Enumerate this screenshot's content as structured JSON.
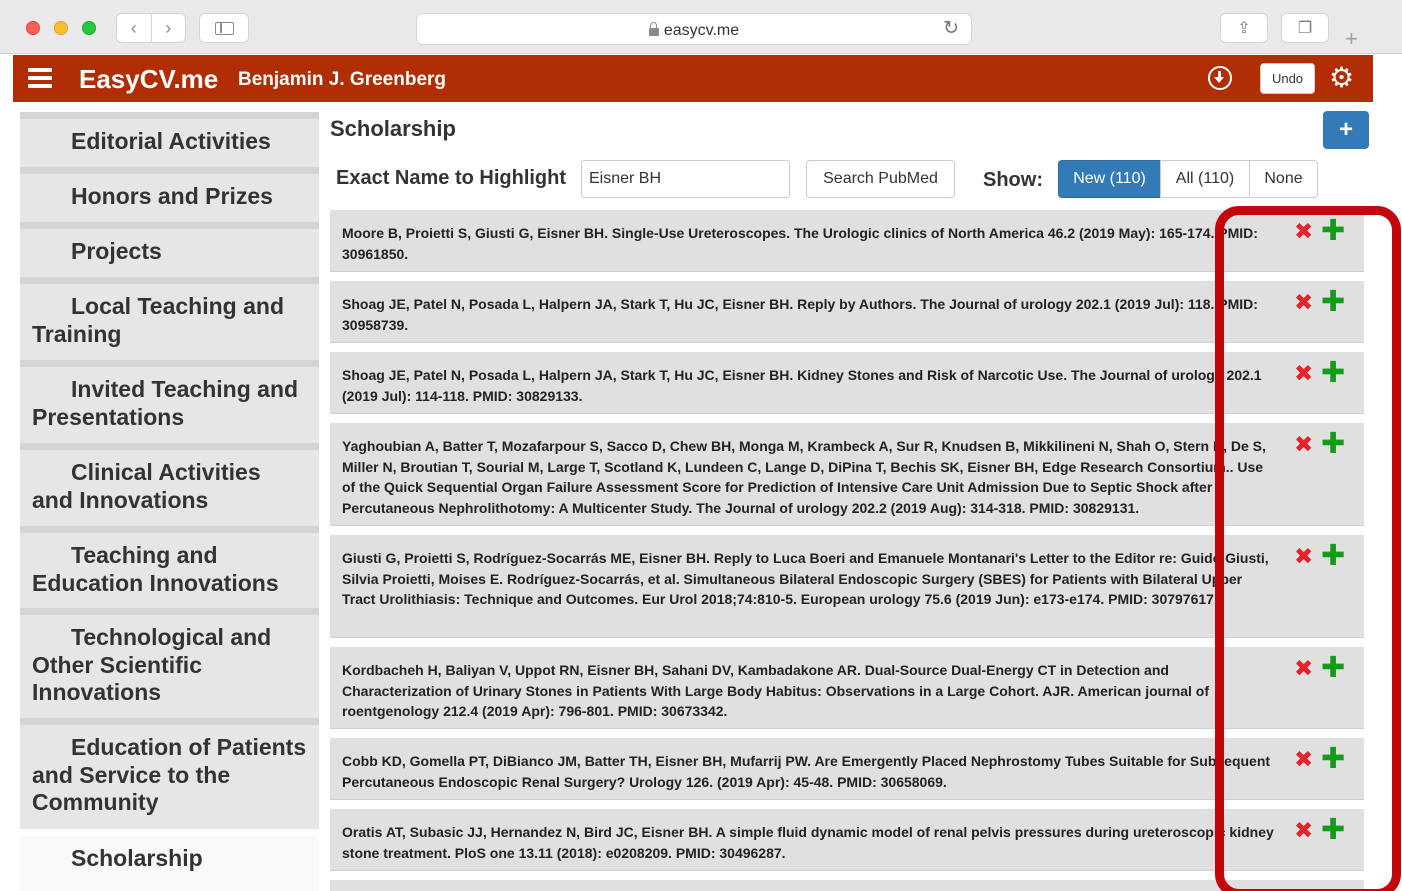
{
  "browser": {
    "url": "easycv.me"
  },
  "header": {
    "brand": "EasyCV.me",
    "person": "Benjamin J. Greenberg",
    "undo_label": "Undo"
  },
  "sidebar": {
    "items": [
      {
        "label": "Editorial Activities"
      },
      {
        "label": "Honors and Prizes"
      },
      {
        "label": "Projects"
      },
      {
        "label": "Local Teaching and Training"
      },
      {
        "label": "Invited Teaching and Presentations"
      },
      {
        "label": "Clinical Activities and Innovations"
      },
      {
        "label": "Teaching and Education Innovations"
      },
      {
        "label": "Technological and Other Scientific Innovations"
      },
      {
        "label": "Education of Patients and Service to the Community"
      },
      {
        "label": "Scholarship"
      }
    ]
  },
  "main": {
    "section_title": "Scholarship",
    "add_label": "+",
    "search_label": "Exact Name to Highlight",
    "search_value": "Eisner BH",
    "pubmed_label": "Search PubMed",
    "show_label": "Show:",
    "filters": {
      "new": "New (110)",
      "all": "All (110)",
      "none": "None"
    },
    "actions": {
      "reject": "✖",
      "accept": "✚"
    },
    "publications": [
      {
        "text": "Moore B, Proietti S, Giusti G, Eisner BH. Single-Use Ureteroscopes. The Urologic clinics of North America 46.2 (2019 May): 165-174. PMID: 30961850."
      },
      {
        "text": "Shoag JE, Patel N, Posada L, Halpern JA, Stark T, Hu JC, Eisner BH. Reply by Authors. The Journal of urology 202.1 (2019 Jul): 118. PMID: 30958739."
      },
      {
        "text": "Shoag JE, Patel N, Posada L, Halpern JA, Stark T, Hu JC, Eisner BH. Kidney Stones and Risk of Narcotic Use. The Journal of urology 202.1 (2019 Jul): 114-118. PMID: 30829133."
      },
      {
        "text": "Yaghoubian A, Batter T, Mozafarpour S, Sacco D, Chew BH, Monga M, Krambeck A, Sur R, Knudsen B, Mikkilineni N, Shah O, Stern K, De S, Miller N, Broutian T, Sourial M, Large T, Scotland K, Lundeen C, Lange D, DiPina T, Bechis SK, Eisner BH, Edge Research Consortium.. Use of the Quick Sequential Organ Failure Assessment Score for Prediction of Intensive Care Unit Admission Due to Septic Shock after Percutaneous Nephrolithotomy: A Multicenter Study. The Journal of urology 202.2 (2019 Aug): 314-318. PMID: 30829131."
      },
      {
        "text": "Giusti G, Proietti S, Rodríguez-Socarrás ME, Eisner BH. Reply to Luca Boeri and Emanuele Montanari's Letter to the Editor re: Guido Giusti, Silvia Proietti, Moises E. Rodríguez-Socarrás, et al. Simultaneous Bilateral Endoscopic Surgery (SBES) for Patients with Bilateral Upper Tract Urolithiasis: Technique and Outcomes. Eur Urol 2018;74:810-5. European urology 75.6 (2019 Jun): e173-e174. PMID: 30797617."
      },
      {
        "text": "Kordbacheh H, Baliyan V, Uppot RN, Eisner BH, Sahani DV, Kambadakone AR. Dual-Source Dual-Energy CT in Detection and Characterization of Urinary Stones in Patients With Large Body Habitus: Observations in a Large Cohort. AJR. American journal of roentgenology 212.4 (2019 Apr): 796-801. PMID: 30673342."
      },
      {
        "text": "Cobb KD, Gomella PT, DiBianco JM, Batter TH, Eisner BH, Mufarrij PW. Are Emergently Placed Nephrostomy Tubes Suitable for Subsequent Percutaneous Endoscopic Renal Surgery? Urology 126. (2019 Apr): 45-48. PMID: 30658069."
      },
      {
        "text": "Oratis AT, Subasic JJ, Hernandez N, Bird JC, Eisner BH. A simple fluid dynamic model of renal pelvis pressures during ureteroscopic kidney stone treatment. PloS one 13.11 (2018): e0208209. PMID: 30496287."
      }
    ]
  },
  "colors": {
    "brand_bar": "#b12e05",
    "primary": "#337ab7",
    "reject": "#e4242b",
    "accept": "#139c18",
    "annotation": "#c5050c"
  }
}
